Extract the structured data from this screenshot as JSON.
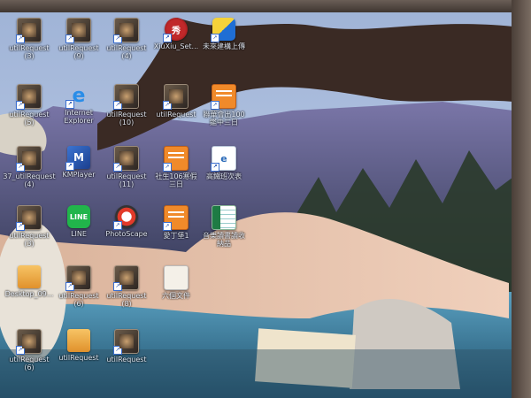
{
  "desktop": {
    "icons": [
      {
        "label": "utilRequest\n(3)",
        "kind": "film"
      },
      {
        "label": "utilRequest\n(9)",
        "kind": "film"
      },
      {
        "label": "utilRequest\n(4)",
        "kind": "film"
      },
      {
        "label": "XiuXiu_Set...",
        "kind": "xiu"
      },
      {
        "label": "未來建構上傳",
        "kind": "sync"
      },
      {
        "label": "utilRequest\n(5)",
        "kind": "film"
      },
      {
        "label": "Internet\nExplorer",
        "kind": "ie"
      },
      {
        "label": "utilRequest\n(10)",
        "kind": "film"
      },
      {
        "label": "utilRequest",
        "kind": "film"
      },
      {
        "label": "聯華會出100\n鑑中三日",
        "kind": "orange"
      },
      {
        "label": "37_utilRequest\n(4)",
        "kind": "film"
      },
      {
        "label": "KMPlayer",
        "kind": "km"
      },
      {
        "label": "utilRequest\n(11)",
        "kind": "film"
      },
      {
        "label": "社生106寒假\n三日",
        "kind": "orange"
      },
      {
        "label": "高鐵班次表",
        "kind": "pdf"
      },
      {
        "label": "utilRequest\n(3)",
        "kind": "film"
      },
      {
        "label": "LINE",
        "kind": "line"
      },
      {
        "label": "PhotoScape",
        "kind": "photo"
      },
      {
        "label": "愛丁堡1",
        "kind": "orange"
      },
      {
        "label": "音樂讀書讀收\n納品",
        "kind": "xls"
      },
      {
        "label": "Desktop_09...",
        "kind": "folder"
      },
      {
        "label": "utilRequest\n(6)",
        "kind": "film"
      },
      {
        "label": "utilRequest\n(8)",
        "kind": "film"
      },
      {
        "label": "六個文件",
        "kind": "doc"
      },
      {
        "label": "utilRequest\n(6)",
        "kind": "film"
      },
      {
        "label": "utilRequest",
        "kind": "folder"
      },
      {
        "label": "utilRequest",
        "kind": "film"
      }
    ]
  }
}
